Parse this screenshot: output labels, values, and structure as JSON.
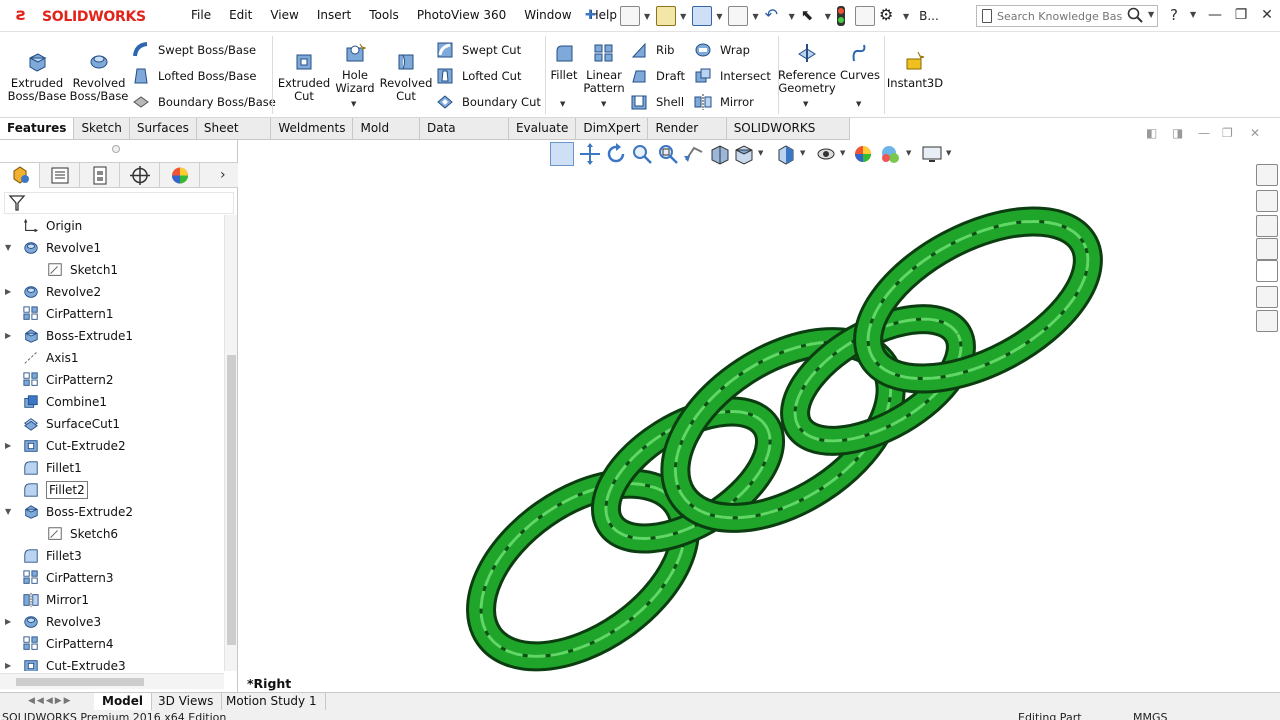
{
  "app": {
    "brand": "SOLIDWORKS",
    "menus": [
      "File",
      "Edit",
      "View",
      "Insert",
      "Tools",
      "PhotoView 360",
      "Window",
      "Help"
    ],
    "search_placeholder": "Search Knowledge Base",
    "help": "?",
    "overflow_label": "B..."
  },
  "features": {
    "extruded_boss": "Extruded\nBoss/Base",
    "revolved_boss": "Revolved\nBoss/Base",
    "swept_boss": "Swept Boss/Base",
    "lofted_boss": "Lofted Boss/Base",
    "boundary_boss": "Boundary Boss/Base",
    "extruded_cut": "Extruded\nCut",
    "hole_wizard": "Hole\nWizard",
    "revolved_cut": "Revolved\nCut",
    "swept_cut": "Swept Cut",
    "lofted_cut": "Lofted Cut",
    "boundary_cut": "Boundary Cut",
    "fillet": "Fillet",
    "linear_pattern": "Linear\nPattern",
    "rib": "Rib",
    "draft": "Draft",
    "shell": "Shell",
    "wrap": "Wrap",
    "intersect": "Intersect",
    "mirror": "Mirror",
    "reference_geometry": "Reference\nGeometry",
    "curves": "Curves",
    "instant3d": "Instant3D"
  },
  "cmd_tabs": [
    "Features",
    "Sketch",
    "Surfaces",
    "Sheet Metal",
    "Weldments",
    "Mold Tools",
    "Data Migration",
    "Evaluate",
    "DimXpert",
    "Render Tools",
    "SOLIDWORKS Add-Ins"
  ],
  "tree": [
    {
      "label": "Origin",
      "icon": "origin-icon",
      "exp": "",
      "indent": 0
    },
    {
      "label": "Revolve1",
      "icon": "revolve-icon",
      "exp": "▼",
      "indent": 0
    },
    {
      "label": "Sketch1",
      "icon": "sketch-icon",
      "exp": "",
      "indent": 1
    },
    {
      "label": "Revolve2",
      "icon": "revolve-icon",
      "exp": "▶",
      "indent": 0
    },
    {
      "label": "CirPattern1",
      "icon": "circular-pattern-icon",
      "exp": "",
      "indent": 0
    },
    {
      "label": "Boss-Extrude1",
      "icon": "extrude-icon",
      "exp": "▶",
      "indent": 0
    },
    {
      "label": "Axis1",
      "icon": "axis-icon",
      "exp": "",
      "indent": 0
    },
    {
      "label": "CirPattern2",
      "icon": "circular-pattern-icon",
      "exp": "",
      "indent": 0
    },
    {
      "label": "Combine1",
      "icon": "combine-icon",
      "exp": "",
      "indent": 0
    },
    {
      "label": "SurfaceCut1",
      "icon": "surface-cut-icon",
      "exp": "",
      "indent": 0
    },
    {
      "label": "Cut-Extrude2",
      "icon": "cut-extrude-icon",
      "exp": "▶",
      "indent": 0
    },
    {
      "label": "Fillet1",
      "icon": "fillet-icon",
      "exp": "",
      "indent": 0
    },
    {
      "label": "Fillet2",
      "icon": "fillet-icon",
      "exp": "",
      "indent": 0,
      "selected": true
    },
    {
      "label": "Boss-Extrude2",
      "icon": "extrude-icon",
      "exp": "▼",
      "indent": 0
    },
    {
      "label": "Sketch6",
      "icon": "sketch-icon",
      "exp": "",
      "indent": 1
    },
    {
      "label": "Fillet3",
      "icon": "fillet-icon",
      "exp": "",
      "indent": 0
    },
    {
      "label": "CirPattern3",
      "icon": "circular-pattern-icon",
      "exp": "",
      "indent": 0
    },
    {
      "label": "Mirror1",
      "icon": "mirror-icon",
      "exp": "",
      "indent": 0
    },
    {
      "label": "Revolve3",
      "icon": "revolve-icon",
      "exp": "▶",
      "indent": 0
    },
    {
      "label": "CirPattern4",
      "icon": "circular-pattern-icon",
      "exp": "",
      "indent": 0
    },
    {
      "label": "Cut-Extrude3",
      "icon": "cut-extrude-icon",
      "exp": "▶",
      "indent": 0
    }
  ],
  "viewport": {
    "view_name": "*Right",
    "model_color": "#1fa52a"
  },
  "bottom_tabs": [
    "Model",
    "3D Views",
    "Motion Study 1"
  ],
  "status": {
    "left": "SOLIDWORKS Premium 2016 x64 Edition",
    "editing": "Editing Part",
    "units": "MMGS"
  }
}
